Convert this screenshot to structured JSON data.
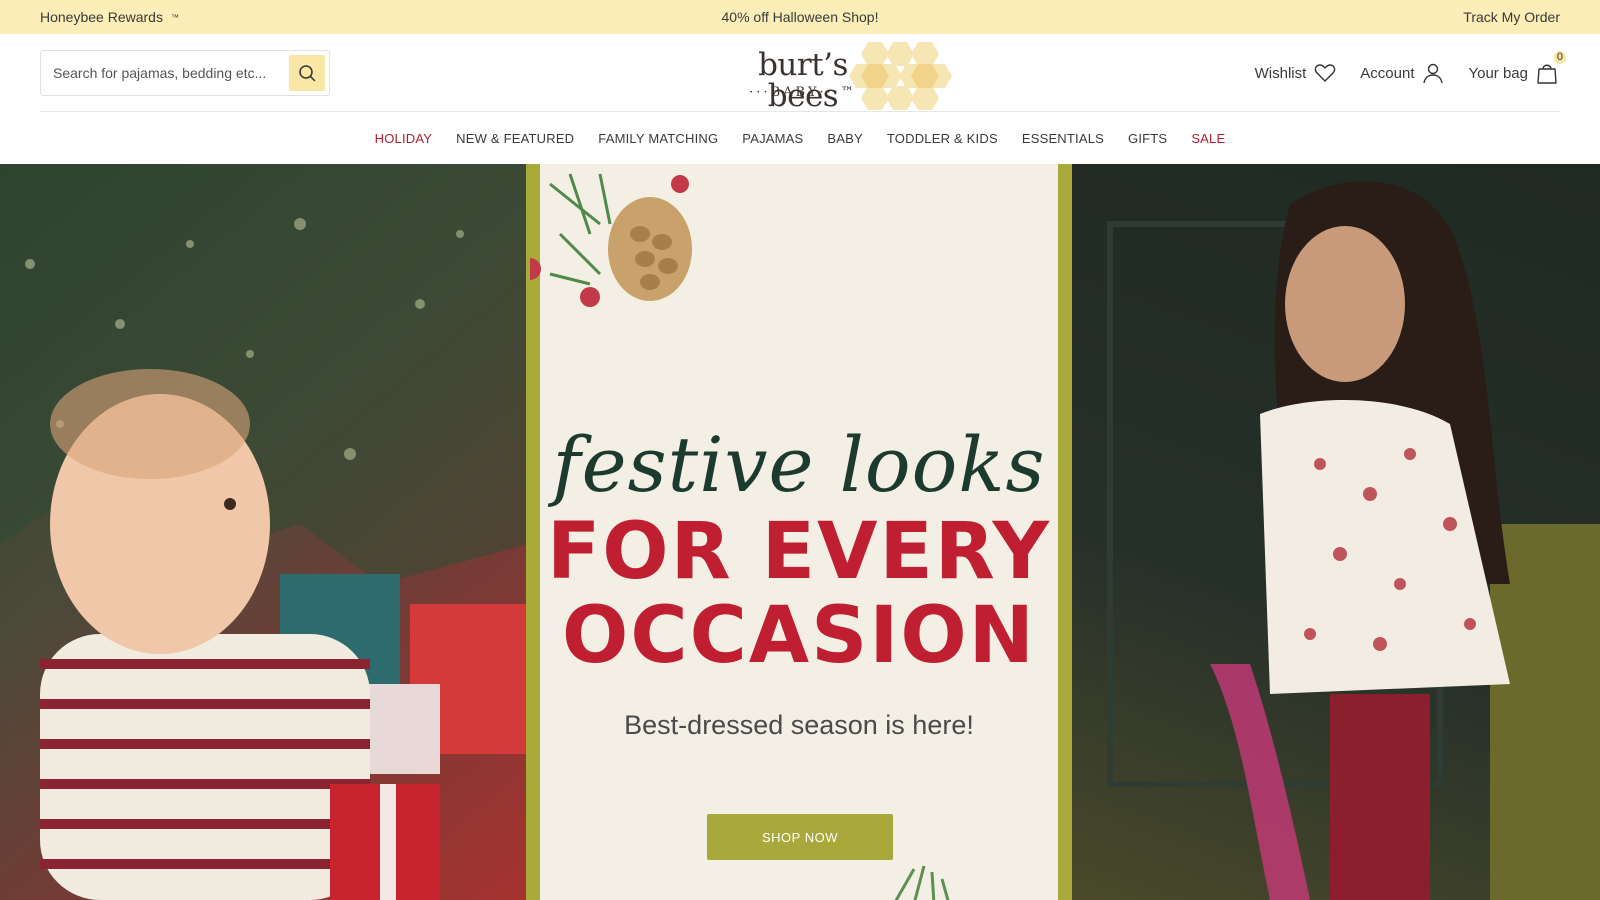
{
  "promo": {
    "rewards": "Honeybee Rewards",
    "rewards_tm": "™",
    "center": "40% off Halloween Shop!",
    "track": "Track My Order"
  },
  "header": {
    "search_placeholder": "Search for pajamas, bedding etc...",
    "logo_main": "burt’s bees",
    "logo_sub": "···BABY···™",
    "wishlist": "Wishlist",
    "account": "Account",
    "bag": "Your bag",
    "bag_count": "0"
  },
  "nav": {
    "items": [
      "HOLIDAY",
      "NEW & FEATURED",
      "FAMILY MATCHING",
      "PAJAMAS",
      "BABY",
      "TODDLER & KIDS",
      "ESSENTIALS",
      "GIFTS",
      "SALE"
    ]
  },
  "hero": {
    "script_headline": "festive looks",
    "headline_line1": "FOR EVERY",
    "headline_line2": "OCCASION",
    "tagline": "Best-dressed season is here!",
    "cta": "SHOP NOW"
  },
  "colors": {
    "promo_bg": "#fbeeb8",
    "accent_red": "#c01f32",
    "cta_green": "#a9a83a",
    "panel_bg": "#f4efe4"
  }
}
